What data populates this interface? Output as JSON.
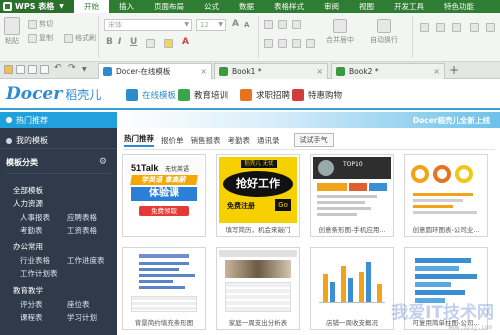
{
  "app": {
    "name": "WPS 表格"
  },
  "menu": [
    "开始",
    "插入",
    "页面布局",
    "公式",
    "数据",
    "表格样式",
    "审阅",
    "视图",
    "开发工具",
    "特色功能"
  ],
  "ribbon": {
    "paste": "粘贴",
    "cut": "剪切",
    "copy": "复制",
    "format_painter": "格式刷",
    "font_name": "宋体",
    "font_size": "12",
    "merge_center": "合并居中",
    "wrap_text": "自动换行"
  },
  "tabs": [
    {
      "label": "Docer-在线模板",
      "active": true
    },
    {
      "label": "Book1 *",
      "active": false
    },
    {
      "label": "Book2 *",
      "active": false
    }
  ],
  "docer": {
    "logo_text": "Docer",
    "logo_cn": "稻壳儿",
    "nav": [
      "在线模板",
      "教育培训",
      "求职招聘",
      "特惠购物"
    ]
  },
  "sidebar": {
    "hot": "热门推荐",
    "my_templates": "我的模板",
    "category_header": "模板分类",
    "categories": [
      {
        "name": "全部模板"
      },
      {
        "name": "人力资源",
        "subs": [
          "人事报表",
          "应聘表格",
          "考勤表",
          "工资表格"
        ]
      },
      {
        "name": "办公常用",
        "subs": [
          "行业表格",
          "工作进度表",
          "工作计划表"
        ]
      },
      {
        "name": "教育教学",
        "subs": [
          "评分表",
          "座位表",
          "课程表",
          "学习计划"
        ]
      }
    ]
  },
  "main": {
    "banner": "Docer稻壳儿全新上线",
    "filters": [
      "热门推荐",
      "报价单",
      "销售报表",
      "考勤表",
      "通讯录"
    ],
    "filter_button": "试试手气",
    "cards": [
      {
        "label": ""
      },
      {
        "label": "填写简历，机会来敲门"
      },
      {
        "label": "创意条形图-手机应用..."
      },
      {
        "label": "创意圆环图表-公司业..."
      },
      {
        "label": "背景简约填充条形图"
      },
      {
        "label": "家庭一周支出分析表"
      },
      {
        "label": "店铺一周收支概况"
      },
      {
        "label": "可复用简单柱图-公司..."
      }
    ],
    "card1": {
      "brand": "51Talk",
      "brand_sub": "无忧英语",
      "band1": "学英语 拿高薪",
      "band2": "体验课",
      "free": "免费领取"
    },
    "card2": {
      "top": "稻壳儿 无忧",
      "big": "抢好工作",
      "line3": "免费注册",
      "go": "Go"
    },
    "card3": {
      "hdr": "TOP10"
    },
    "watermark": "我爱IT技术网",
    "watermark_url": "www.52ij.com"
  },
  "colors": {
    "title_green": "#2f7d32",
    "sidebar_bg": "#2f3b4a",
    "highlight_blue": "#20a0dc",
    "docer_blue": "#2d8ccf"
  }
}
